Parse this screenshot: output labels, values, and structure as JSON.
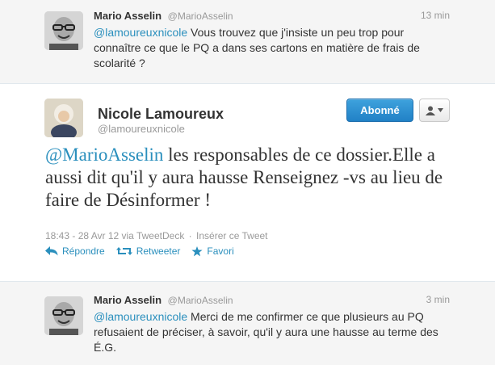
{
  "reply_top": {
    "author_name": "Mario Asselin",
    "author_handle": "@MarioAsselin",
    "time": "13 min",
    "mention": "@lamoureuxnicole",
    "text": " Vous trouvez que j'insiste un peu trop pour connaître ce que le PQ a dans ses cartons en matière de frais de scolarité ?"
  },
  "main_tweet": {
    "author_name": "Nicole Lamoureux",
    "author_handle": "@lamoureuxnicole",
    "follow_label": "Abonné",
    "mention": "@MarioAsselin",
    "text": " les responsables de ce dossier.Elle a aussi dit qu'il y aura hausse Renseignez -vs au lieu de faire de Désinformer !",
    "timestamp": "18:43 - 28 Avr 12 via TweetDeck",
    "separator": "·",
    "embed_label": "Insérer ce Tweet",
    "actions": {
      "reply": "Répondre",
      "retweet": "Retweeter",
      "favorite": "Favori"
    }
  },
  "reply_bottom": {
    "author_name": "Mario Asselin",
    "author_handle": "@MarioAsselin",
    "time": "3 min",
    "mention": "@lamoureuxnicole",
    "text": " Merci de me confirmer ce que plusieurs au PQ refusaient de préciser, à savoir, qu'il y aura une hausse au terme des É.G."
  },
  "colors": {
    "link": "#2a8fbd",
    "follow_button": "#2181c6",
    "muted": "#999999"
  }
}
